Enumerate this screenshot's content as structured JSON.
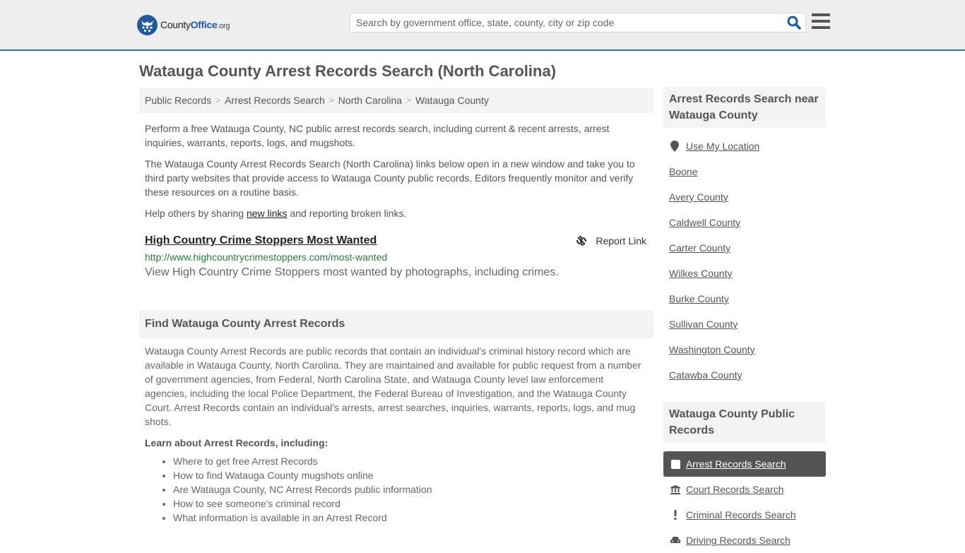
{
  "header": {
    "logo": {
      "name_part1": "County",
      "name_part2": "Office",
      "name_part3": ".org"
    },
    "search": {
      "placeholder": "Search by government office, state, county, city or zip code",
      "value": ""
    },
    "colors": {
      "accent": "#2d74a9",
      "brand": "#1f5a9c",
      "header_bg": "#eeeeee"
    }
  },
  "page": {
    "title": "Watauga County Arrest Records Search (North Carolina)"
  },
  "breadcrumb": [
    {
      "label": "Public Records"
    },
    {
      "label": "Arrest Records Search"
    },
    {
      "label": "North Carolina"
    },
    {
      "label": "Watauga County"
    }
  ],
  "intro": {
    "p1": "Perform a free Watauga County, NC public arrest records search, including current & recent arrests, arrest inquiries, warrants, reports, logs, and mugshots.",
    "p2": "The Watauga County Arrest Records Search (North Carolina) links below open in a new window and take you to third party websites that provide access to Watauga County public records. Editors frequently monitor and verify these resources on a routine basis.",
    "p3_before": "Help others by sharing ",
    "p3_link": "new links",
    "p3_after": " and reporting broken links."
  },
  "links": [
    {
      "title": "High Country Crime Stoppers Most Wanted",
      "url": "http://www.highcountrycrimestoppers.com/most-wanted",
      "description": "View High Country Crime Stoppers most wanted by photographs, including crimes.",
      "report_label": "Report Link",
      "url_color": "#2a7a3e"
    }
  ],
  "find_section": {
    "heading": "Find Watauga County Arrest Records",
    "body": "Watauga County Arrest Records are public records that contain an individual's criminal history record which are available in Watauga County, North Carolina. They are maintained and available for public request from a number of government agencies, from Federal, North Carolina State, and Watauga County level law enforcement agencies, including the local Police Department, the Federal Bureau of Investigation, and the Watauga County Court. Arrest Records contain an individual's arrests, arrest searches, inquiries, warrants, reports, logs, and mug shots.",
    "learn_heading": "Learn about Arrest Records, including:",
    "learn_items": [
      "Where to get free Arrest Records",
      "How to find Watauga County mugshots online",
      "Are Watauga County, NC Arrest Records public information",
      "How to see someone's criminal record",
      "What information is available in an Arrest Record"
    ]
  },
  "sidebar": {
    "nearby_heading": "Arrest Records Search near Watauga County",
    "use_location": "Use My Location",
    "nearby": [
      "Boone",
      "Avery County",
      "Caldwell County",
      "Carter County",
      "Wilkes County",
      "Burke County",
      "Sullivan County",
      "Washington County",
      "Catawba County"
    ],
    "records_heading": "Watauga County Public Records",
    "records": [
      {
        "label": "Arrest Records Search",
        "icon": "square-icon",
        "active": true
      },
      {
        "label": "Court Records Search",
        "icon": "courthouse-icon",
        "active": false
      },
      {
        "label": "Criminal Records Search",
        "icon": "exclamation-icon",
        "active": false
      },
      {
        "label": "Driving Records Search",
        "icon": "car-icon",
        "active": false
      }
    ]
  }
}
